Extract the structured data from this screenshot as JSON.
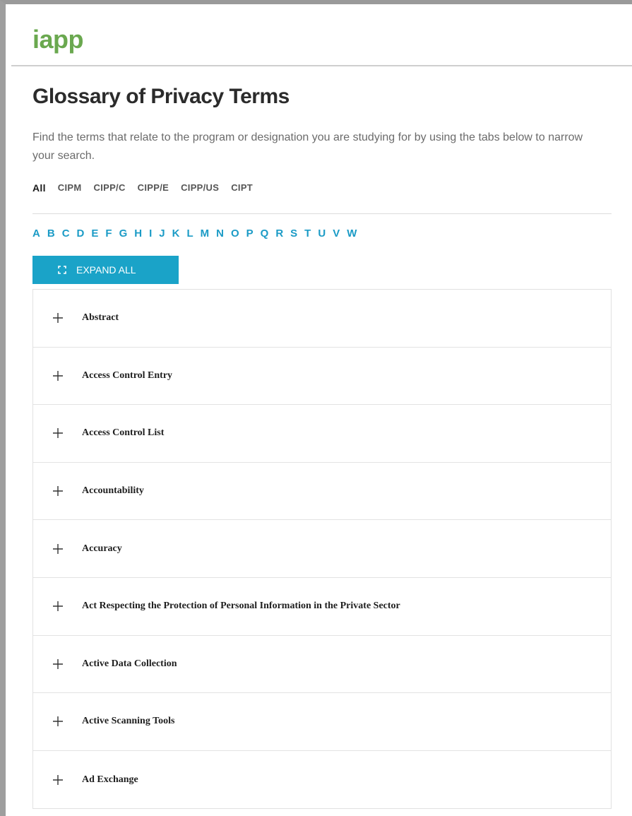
{
  "brand": {
    "logo_text": "iapp",
    "logo_color": "#6aa84f"
  },
  "page": {
    "title": "Glossary of Privacy Terms",
    "intro": "Find the terms that relate to the program or designation you are studying for by using the tabs below to narrow your search."
  },
  "tabs": [
    {
      "label": "All",
      "active": true
    },
    {
      "label": "CIPM"
    },
    {
      "label": "CIPP/C"
    },
    {
      "label": "CIPP/E"
    },
    {
      "label": "CIPP/US"
    },
    {
      "label": "CIPT"
    }
  ],
  "letters": [
    "A",
    "B",
    "C",
    "D",
    "E",
    "F",
    "G",
    "H",
    "I",
    "J",
    "K",
    "L",
    "M",
    "N",
    "O",
    "P",
    "Q",
    "R",
    "S",
    "T",
    "U",
    "V",
    "W"
  ],
  "colors": {
    "accent": "#1b9bc6",
    "button_bg": "#1aa3c8"
  },
  "expand_button": {
    "label": "EXPAND ALL",
    "icon": "expand-icon"
  },
  "terms": [
    {
      "label": "Abstract"
    },
    {
      "label": "Access Control Entry"
    },
    {
      "label": "Access Control List"
    },
    {
      "label": "Accountability"
    },
    {
      "label": "Accuracy"
    },
    {
      "label": "Act Respecting the Protection of Personal Information in the Private Sector"
    },
    {
      "label": "Active Data Collection"
    },
    {
      "label": "Active Scanning Tools"
    },
    {
      "label": "Ad Exchange"
    }
  ]
}
